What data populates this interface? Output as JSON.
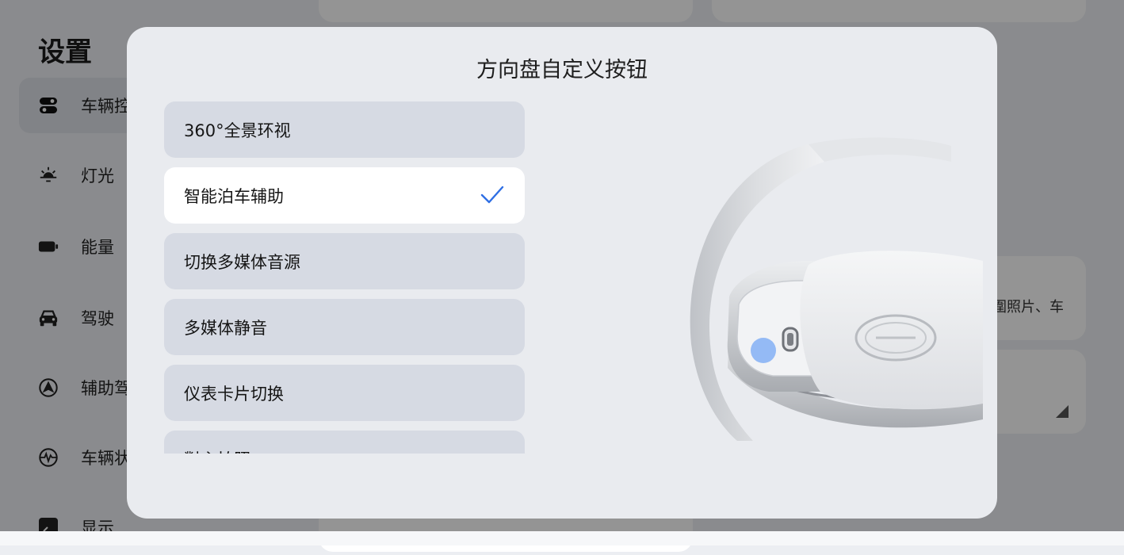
{
  "settings": {
    "title": "设置",
    "nav": [
      {
        "label": "车辆控",
        "icon": "toggle-icon",
        "active": true
      },
      {
        "label": "灯光",
        "icon": "light-icon"
      },
      {
        "label": "能量",
        "icon": "battery-icon"
      },
      {
        "label": "驾驶",
        "icon": "car-icon"
      },
      {
        "label": "辅助驾",
        "icon": "assist-drive-icon"
      },
      {
        "label": "车辆状",
        "icon": "vehicle-status-icon"
      },
      {
        "label": "显示",
        "icon": "display-icon"
      }
    ],
    "right_card_text": "圍照片、车"
  },
  "dialog": {
    "title": "方向盘自定义按钮",
    "options": [
      {
        "label": "360°全景环视",
        "selected": false
      },
      {
        "label": "智能泊车辅助",
        "selected": true
      },
      {
        "label": "切换多媒体音源",
        "selected": false
      },
      {
        "label": "多媒体静音",
        "selected": false
      },
      {
        "label": "仪表卡片切换",
        "selected": false
      },
      {
        "label": "對主拍照",
        "selected": false
      }
    ]
  },
  "colors": {
    "accent": "#2f6fe4",
    "button_highlight": "#8ab4f5",
    "scrim": "rgba(0,0,0,0.42)"
  }
}
